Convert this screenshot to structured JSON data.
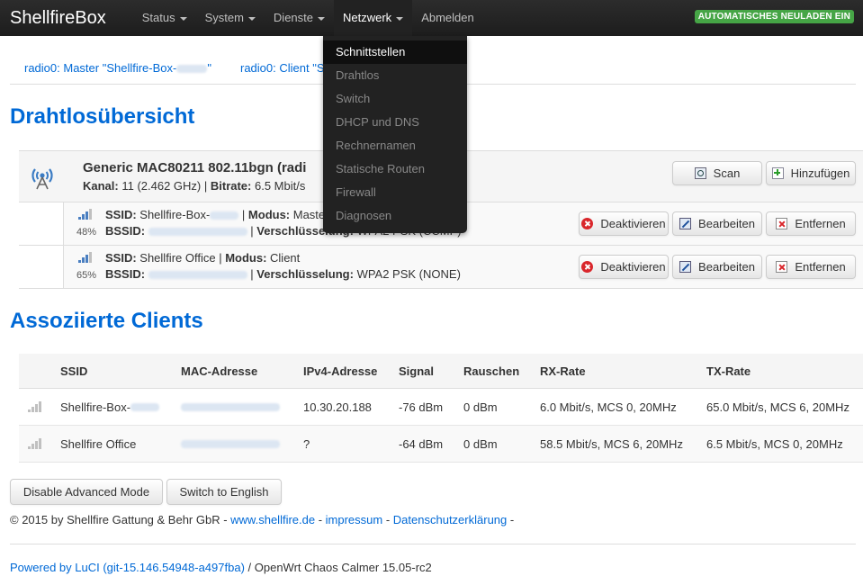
{
  "brand": "ShellfireBox",
  "nav": [
    {
      "label": "Status"
    },
    {
      "label": "System"
    },
    {
      "label": "Dienste"
    },
    {
      "label": "Netzwerk"
    },
    {
      "label": "Abmelden"
    }
  ],
  "reload_badge": "AUTOMATISCHES NEULADEN EIN",
  "dropdown": [
    "Schnittstellen",
    "Drahtlos",
    "Switch",
    "DHCP und DNS",
    "Rechnernamen",
    "Statische Routen",
    "Firewall",
    "Diagnosen"
  ],
  "tabs": [
    "radio0: Master \"Shellfire-Box-",
    "\"",
    "radio0: Client \"S"
  ],
  "section1_title": "Drahtlosübersicht",
  "device": {
    "name": "Generic MAC80211 802.11bgn (radi",
    "channel_label": "Kanal:",
    "channel_value": " 11 (2.462 GHz) | ",
    "bitrate_label": "Bitrate:",
    "bitrate_value": " 6.5 Mbit/s",
    "scan_label": "Scan",
    "add_label": "Hinzufügen"
  },
  "networks": [
    {
      "signal": "48%",
      "ssid_label": "SSID:",
      "ssid_value": " Shellfire-Box-",
      "mode_sep": " | ",
      "mode_label": "Modus:",
      "mode_value": " Maste",
      "bssid_label": "BSSID:",
      "enc_sep": " | ",
      "enc_label": "Verschlüsselung:",
      "enc_value": " WPA2 PSK (CCMP)"
    },
    {
      "signal": "65%",
      "ssid_label": "SSID:",
      "ssid_value": " Shellfire Office",
      "mode_sep": " | ",
      "mode_label": "Modus:",
      "mode_value": " Client",
      "bssid_label": "BSSID:",
      "enc_sep": " | ",
      "enc_label": "Verschlüsselung:",
      "enc_value": " WPA2 PSK (NONE)"
    }
  ],
  "net_buttons": {
    "deactivate": "Deaktivieren",
    "edit": "Bearbeiten",
    "remove": "Entfernen"
  },
  "section2_title": "Assoziierte Clients",
  "clients_headers": [
    "SSID",
    "MAC-Adresse",
    "IPv4-Adresse",
    "Signal",
    "Rauschen",
    "RX-Rate",
    "TX-Rate"
  ],
  "clients_rows": [
    {
      "ssid": "Shellfire-Box-",
      "ipv4": "10.30.20.188",
      "signal": "-76 dBm",
      "noise": "0 dBm",
      "rx": "6.0 Mbit/s, MCS 0, 20MHz",
      "tx": "65.0 Mbit/s, MCS 6, 20MHz"
    },
    {
      "ssid": "Shellfire Office",
      "ipv4": "?",
      "signal": "-64 dBm",
      "noise": "0 dBm",
      "rx": "58.5 Mbit/s, MCS 6, 20MHz",
      "tx": "6.5 Mbit/s, MCS 0, 20MHz"
    }
  ],
  "footer_buttons": {
    "advanced": "Disable Advanced Mode",
    "english": "Switch to English"
  },
  "copyright": {
    "text": "© 2015 by Shellfire Gattung & Behr GbR - ",
    "link1": "www.shellfire.de",
    "sep1": " - ",
    "link2": "impressum",
    "sep2": " - ",
    "link3": "Datenschutzerklärung",
    "sep3": " -"
  },
  "powered": {
    "link": "Powered by LuCI (git-15.146.54948-a497fba)",
    "text": " / OpenWrt Chaos Calmer 15.05-rc2"
  },
  "colors": {
    "accent": "#0069d6",
    "badge": "#46a546",
    "topbar": "#1d1d1d"
  }
}
